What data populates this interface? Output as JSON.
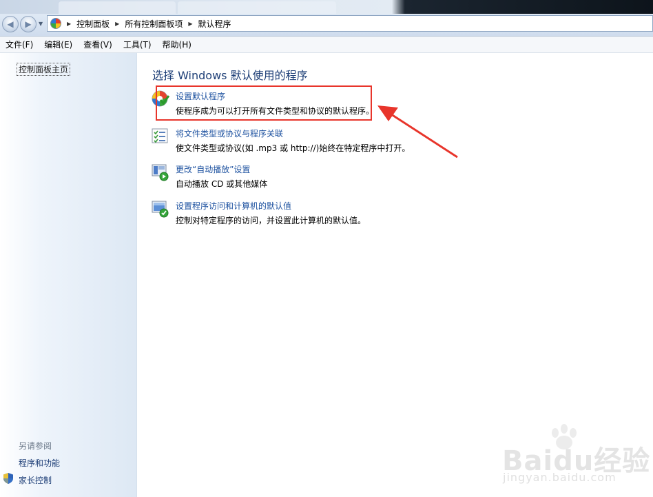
{
  "breadcrumbs": [
    "控制面板",
    "所有控制面板项",
    "默认程序"
  ],
  "menu": [
    "文件(F)",
    "编辑(E)",
    "查看(V)",
    "工具(T)",
    "帮助(H)"
  ],
  "sidebar": {
    "home": "控制面板主页",
    "see_also": "另请参阅",
    "links": [
      "程序和功能",
      "家长控制"
    ]
  },
  "main": {
    "title": "选择 Windows 默认使用的程序",
    "items": [
      {
        "link": "设置默认程序",
        "desc": "使程序成为可以打开所有文件类型和协议的默认程序。",
        "icon": "default-programs-icon"
      },
      {
        "link": "将文件类型或协议与程序关联",
        "desc": "使文件类型或协议(如 .mp3 或 http://)始终在特定程序中打开。",
        "icon": "file-association-icon"
      },
      {
        "link": "更改“自动播放”设置",
        "desc": "自动播放 CD 或其他媒体",
        "icon": "autoplay-icon"
      },
      {
        "link": "设置程序访问和计算机的默认值",
        "desc": "控制对特定程序的访问，并设置此计算机的默认值。",
        "icon": "program-access-icon"
      }
    ]
  },
  "watermark": {
    "brand": "Baidu经验",
    "url": "jingyan.baidu.com"
  },
  "colors": {
    "link": "#1e52a0",
    "title": "#1e3f77",
    "annotation": "#e8352b"
  }
}
